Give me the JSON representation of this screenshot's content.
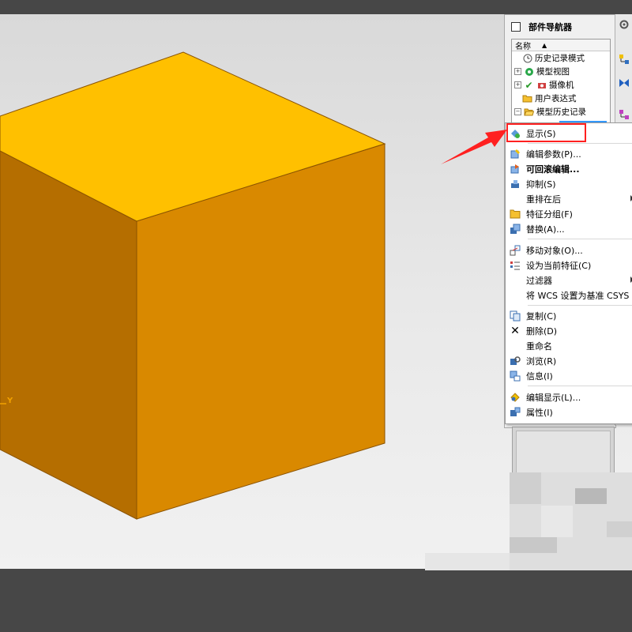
{
  "navigator": {
    "title": "部件导航器",
    "column_name": "名称",
    "tree": [
      {
        "label": "历史记录模式",
        "icon": "clock-icon",
        "expander": ""
      },
      {
        "label": "模型视图",
        "icon": "model-view-icon",
        "expander": "+"
      },
      {
        "label": "摄像机",
        "icon": "camera-icon",
        "expander": "+"
      },
      {
        "label": "用户表达式",
        "icon": "folder-icon",
        "expander": ""
      },
      {
        "label": "模型历史记录",
        "icon": "folder-open-icon",
        "expander": "−"
      }
    ]
  },
  "viewport": {
    "axis_label": "Y",
    "cube_colors": {
      "top": "#ffc000",
      "left": "#b56e00",
      "right": "#d98900"
    }
  },
  "context_menu": {
    "items": [
      {
        "label": "显示(S)",
        "icon": "show-icon",
        "bold": false
      },
      {
        "label": "编辑参数(P)...",
        "icon": "edit-params-icon",
        "bold": false
      },
      {
        "label": "可回滚编辑...",
        "icon": "rollback-edit-icon",
        "bold": true
      },
      {
        "label": "抑制(S)",
        "icon": "suppress-icon",
        "bold": false
      },
      {
        "label": "重排在后",
        "icon": "",
        "bold": false,
        "submenu": true
      },
      {
        "label": "特征分组(F)",
        "icon": "feature-group-icon",
        "bold": false
      },
      {
        "label": "替换(A)...",
        "icon": "replace-icon",
        "bold": false
      },
      {
        "label": "移动对象(O)...",
        "icon": "move-object-icon",
        "bold": false
      },
      {
        "label": "设为当前特征(C)",
        "icon": "current-feature-icon",
        "bold": false
      },
      {
        "label": "过滤器",
        "icon": "",
        "bold": false,
        "submenu": true
      },
      {
        "label": "将 WCS 设置为基准 CSYS",
        "icon": "",
        "bold": false
      },
      {
        "label": "复制(C)",
        "icon": "copy-icon",
        "bold": false
      },
      {
        "label": "删除(D)",
        "icon": "delete-icon",
        "bold": false
      },
      {
        "label": "重命名",
        "icon": "",
        "bold": false
      },
      {
        "label": "浏览(R)",
        "icon": "browse-icon",
        "bold": false
      },
      {
        "label": "信息(I)",
        "icon": "info-icon",
        "bold": false
      },
      {
        "label": "编辑显示(L)...",
        "icon": "edit-display-icon",
        "bold": false
      },
      {
        "label": "属性(I)",
        "icon": "properties-icon",
        "bold": false
      }
    ]
  },
  "colors": {
    "highlight": "#ff2020",
    "menu_bg": "#ffffff",
    "selection": "#3399ff"
  }
}
